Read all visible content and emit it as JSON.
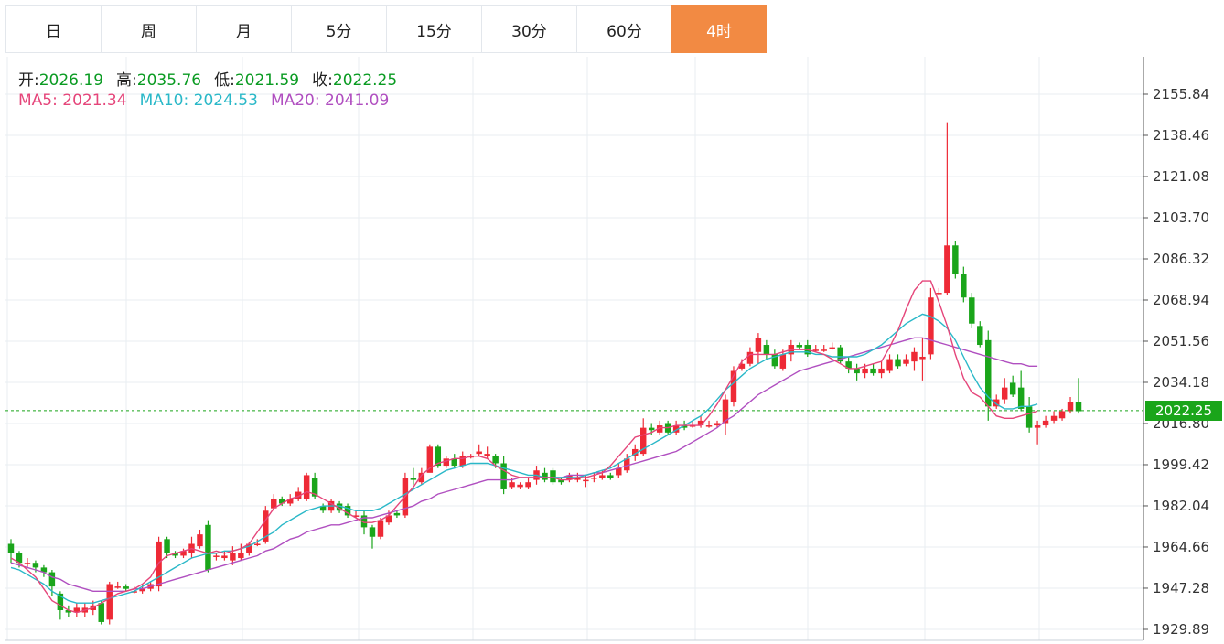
{
  "tabs": [
    {
      "label": "日",
      "active": false
    },
    {
      "label": "周",
      "active": false
    },
    {
      "label": "月",
      "active": false
    },
    {
      "label": "5分",
      "active": false
    },
    {
      "label": "15分",
      "active": false
    },
    {
      "label": "30分",
      "active": false
    },
    {
      "label": "60分",
      "active": false
    },
    {
      "label": "4时",
      "active": true
    }
  ],
  "ohlc": {
    "open_label": "开:",
    "open": "2026.19",
    "high_label": "高:",
    "high": "2035.76",
    "low_label": "低:",
    "low": "2021.59",
    "close_label": "收:",
    "close": "2022.25"
  },
  "ma": {
    "ma5_label": "MA5:",
    "ma5": "2021.34",
    "ma10_label": "MA10:",
    "ma10": "2024.53",
    "ma20_label": "MA20:",
    "ma20": "2041.09"
  },
  "current_price": "2022.25",
  "colors": {
    "up": "#ee2a36",
    "down": "#1aa51a",
    "ma5": "#e5457a",
    "ma10": "#2ab8c8",
    "ma20": "#b04fc0",
    "active_tab": "#f28a43"
  },
  "chart_data": {
    "type": "candlestick",
    "y_tick_labels": [
      "2155.84",
      "2138.46",
      "2121.08",
      "2103.70",
      "2086.32",
      "2068.94",
      "2051.56",
      "2034.18",
      "2016.80",
      "1999.42",
      "1982.04",
      "1964.66",
      "1947.28",
      "1929.89"
    ],
    "ylim": [
      1926,
      2165
    ],
    "current_price": 2022.25,
    "candles": [
      [
        1966,
        1962,
        1968,
        1958
      ],
      [
        1962,
        1958,
        1963,
        1956
      ],
      [
        1958,
        1958,
        1960,
        1956
      ],
      [
        1958,
        1956,
        1959,
        1954
      ],
      [
        1956,
        1954,
        1957,
        1952
      ],
      [
        1954,
        1948,
        1955,
        1944
      ],
      [
        1945,
        1938,
        1946,
        1934
      ],
      [
        1938,
        1937,
        1940,
        1935
      ],
      [
        1937,
        1939,
        1941,
        1935
      ],
      [
        1937,
        1939,
        1941,
        1935
      ],
      [
        1938,
        1940,
        1942,
        1936
      ],
      [
        1941,
        1933,
        1942,
        1932
      ],
      [
        1934,
        1949,
        1950,
        1932
      ],
      [
        1948,
        1948,
        1950,
        1947
      ],
      [
        1948,
        1947,
        1949,
        1946
      ],
      [
        1946,
        1946,
        1948,
        1945
      ],
      [
        1946,
        1947,
        1949,
        1945
      ],
      [
        1947,
        1949,
        1950,
        1946
      ],
      [
        1948,
        1967,
        1969,
        1946
      ],
      [
        1968,
        1962,
        1969,
        1960
      ],
      [
        1962,
        1961,
        1963,
        1960
      ],
      [
        1961,
        1963,
        1964,
        1960
      ],
      [
        1962,
        1966,
        1969,
        1960
      ],
      [
        1965,
        1970,
        1972,
        1964
      ],
      [
        1974,
        1955,
        1976,
        1954
      ],
      [
        1961,
        1961,
        1962,
        1959
      ],
      [
        1960,
        1961,
        1963,
        1959
      ],
      [
        1959,
        1962,
        1965,
        1957
      ],
      [
        1960,
        1962,
        1966,
        1959
      ],
      [
        1962,
        1966,
        1967,
        1961
      ],
      [
        1966,
        1966,
        1968,
        1965
      ],
      [
        1967,
        1980,
        1982,
        1966
      ],
      [
        1981,
        1985,
        1987,
        1980
      ],
      [
        1985,
        1983,
        1986,
        1982
      ],
      [
        1983,
        1985,
        1987,
        1982
      ],
      [
        1985,
        1988,
        1990,
        1984
      ],
      [
        1985,
        1995,
        1996,
        1984
      ],
      [
        1994,
        1986,
        1996,
        1985
      ],
      [
        1982,
        1980,
        1983,
        1979
      ],
      [
        1980,
        1984,
        1985,
        1979
      ],
      [
        1983,
        1980,
        1984,
        1979
      ],
      [
        1982,
        1978,
        1983,
        1977
      ],
      [
        1978,
        1978,
        1980,
        1977
      ],
      [
        1978,
        1973,
        1980,
        1970
      ],
      [
        1973,
        1969,
        1974,
        1964
      ],
      [
        1969,
        1976,
        1977,
        1968
      ],
      [
        1975,
        1978,
        1980,
        1974
      ],
      [
        1979,
        1978,
        1980,
        1977
      ],
      [
        1978,
        1994,
        1996,
        1977
      ],
      [
        1994,
        1993,
        1998,
        1991
      ],
      [
        1992,
        1996,
        1998,
        1991
      ],
      [
        1996,
        2007,
        2008,
        2003
      ],
      [
        2007,
        1999,
        2008,
        1998
      ],
      [
        1999,
        2002,
        2003,
        1998
      ],
      [
        2002,
        1999,
        2004,
        1998
      ],
      [
        1999,
        2003,
        2005,
        1998
      ],
      [
        2003,
        2003,
        2004,
        2002
      ],
      [
        2004,
        2005,
        2008,
        2003
      ],
      [
        2003,
        2004,
        2007,
        2002
      ],
      [
        2003,
        2000,
        2004,
        1998
      ],
      [
        2000,
        1989,
        2003,
        1987
      ],
      [
        1990,
        1992,
        1994,
        1989
      ],
      [
        1990,
        1991,
        1992,
        1989
      ],
      [
        1990,
        1992,
        1994,
        1989
      ],
      [
        1993,
        1997,
        1999,
        1991
      ],
      [
        1996,
        1993,
        1998,
        1992
      ],
      [
        1997,
        1992,
        1998,
        1991
      ],
      [
        1993,
        1992,
        1994,
        1991
      ],
      [
        1993,
        1995,
        1996,
        1992
      ],
      [
        1993,
        1994,
        1996,
        1992
      ],
      [
        1993,
        1993,
        1995,
        1990
      ],
      [
        1994,
        1994,
        1996,
        1992
      ],
      [
        1994,
        1995,
        1997,
        1993
      ],
      [
        1995,
        1994,
        1996,
        1993
      ],
      [
        1995,
        1998,
        2000,
        1994
      ],
      [
        1997,
        2002,
        2004,
        1996
      ],
      [
        2003,
        2006,
        2008,
        2001
      ],
      [
        2004,
        2015,
        2019,
        2003
      ],
      [
        2015,
        2014,
        2017,
        2012
      ],
      [
        2013,
        2016,
        2018,
        2012
      ],
      [
        2017,
        2013,
        2018,
        2012
      ],
      [
        2013,
        2016,
        2018,
        2012
      ],
      [
        2016,
        2015,
        2018,
        2014
      ],
      [
        2016,
        2016,
        2018,
        2015
      ],
      [
        2016,
        2018,
        2020,
        2015
      ],
      [
        2016,
        2016,
        2018,
        2015
      ],
      [
        2016,
        2017,
        2018,
        2015
      ],
      [
        2017,
        2027,
        2029,
        2012
      ],
      [
        2026,
        2039,
        2041,
        2024
      ],
      [
        2040,
        2042,
        2044,
        2039
      ],
      [
        2042,
        2047,
        2049,
        2041
      ],
      [
        2047,
        2053,
        2055,
        2042
      ],
      [
        2050,
        2046,
        2052,
        2044
      ],
      [
        2046,
        2041,
        2048,
        2040
      ],
      [
        2040,
        2046,
        2048,
        2039
      ],
      [
        2046,
        2050,
        2052,
        2043
      ],
      [
        2050,
        2049,
        2051,
        2048
      ],
      [
        2050,
        2046,
        2052,
        2045
      ],
      [
        2048,
        2048,
        2050,
        2047
      ],
      [
        2048,
        2048,
        2050,
        2047
      ],
      [
        2049,
        2049,
        2051,
        2048
      ],
      [
        2049,
        2043,
        2050,
        2042
      ],
      [
        2043,
        2040,
        2045,
        2038
      ],
      [
        2040,
        2038,
        2042,
        2035
      ],
      [
        2038,
        2040,
        2042,
        2036
      ],
      [
        2040,
        2038,
        2042,
        2037
      ],
      [
        2038,
        2040,
        2043,
        2036
      ],
      [
        2039,
        2044,
        2046,
        2038
      ],
      [
        2044,
        2041,
        2046,
        2040
      ],
      [
        2042,
        2044,
        2046,
        2041
      ],
      [
        2043,
        2047,
        2049,
        2039
      ],
      [
        2044,
        2045,
        2053,
        2035
      ],
      [
        2046,
        2070,
        2074,
        2044
      ],
      [
        2072,
        2072,
        2074,
        2071
      ],
      [
        2072,
        2092,
        2144,
        2071
      ],
      [
        2092,
        2080,
        2094,
        2078
      ],
      [
        2080,
        2070,
        2083,
        2068
      ],
      [
        2070,
        2059,
        2072,
        2057
      ],
      [
        2058,
        2050,
        2060,
        2049
      ],
      [
        2052,
        2024,
        2056,
        2018
      ],
      [
        2024,
        2027,
        2029,
        2023
      ],
      [
        2027,
        2032,
        2036,
        2025
      ],
      [
        2034,
        2029,
        2037,
        2028
      ],
      [
        2032,
        2023,
        2039,
        2022
      ],
      [
        2024,
        2015,
        2028,
        2013
      ],
      [
        2015,
        2016,
        2018,
        2008
      ],
      [
        2016,
        2018,
        2020,
        2015
      ],
      [
        2018,
        2020,
        2022,
        2017
      ],
      [
        2019,
        2022,
        2023,
        2018
      ],
      [
        2022,
        2026,
        2028,
        2021
      ],
      [
        2026,
        2022,
        2036,
        2021
      ]
    ],
    "ma5": [
      1960,
      1958,
      1955,
      1952,
      1947,
      1942,
      1940,
      1938,
      1937,
      1938,
      1939,
      1941,
      1943,
      1945,
      1946,
      1947,
      1949,
      1952,
      1958,
      1961,
      1962,
      1963,
      1964,
      1963,
      1962,
      1963,
      1962,
      1963,
      1964,
      1966,
      1971,
      1976,
      1981,
      1983,
      1985,
      1986,
      1988,
      1987,
      1985,
      1983,
      1981,
      1979,
      1977,
      1975,
      1975,
      1976,
      1978,
      1982,
      1986,
      1990,
      1995,
      1998,
      2000,
      2001,
      2002,
      2002,
      2003,
      2003,
      2002,
      1999,
      1997,
      1995,
      1994,
      1994,
      1994,
      1994,
      1994,
      1993,
      1993,
      1994,
      1994,
      1995,
      1996,
      1999,
      2003,
      2007,
      2011,
      2012,
      2013,
      2015,
      2015,
      2016,
      2016,
      2016,
      2016,
      2020,
      2025,
      2031,
      2037,
      2043,
      2046,
      2046,
      2046,
      2046,
      2047,
      2048,
      2048,
      2048,
      2047,
      2046,
      2044,
      2042,
      2040,
      2040,
      2041,
      2042,
      2043,
      2049,
      2056,
      2065,
      2073,
      2077,
      2077,
      2068,
      2058,
      2046,
      2036,
      2030,
      2028,
      2024,
      2020,
      2019,
      2019,
      2020,
      2021,
      2022
    ],
    "ma10": [
      1956,
      1955,
      1953,
      1951,
      1949,
      1946,
      1944,
      1942,
      1941,
      1941,
      1941,
      1942,
      1943,
      1944,
      1945,
      1946,
      1948,
      1950,
      1952,
      1954,
      1956,
      1958,
      1960,
      1961,
      1962,
      1962,
      1963,
      1963,
      1964,
      1965,
      1967,
      1969,
      1971,
      1974,
      1976,
      1978,
      1980,
      1981,
      1982,
      1982,
      1982,
      1981,
      1980,
      1980,
      1980,
      1981,
      1983,
      1985,
      1987,
      1989,
      1991,
      1993,
      1995,
      1997,
      1998,
      1999,
      2000,
      2000,
      2000,
      1999,
      1998,
      1997,
      1996,
      1995,
      1995,
      1994,
      1994,
      1994,
      1994,
      1994,
      1995,
      1996,
      1997,
      1998,
      2000,
      2002,
      2004,
      2006,
      2008,
      2010,
      2012,
      2014,
      2016,
      2018,
      2020,
      2023,
      2027,
      2031,
      2034,
      2037,
      2040,
      2042,
      2044,
      2045,
      2046,
      2047,
      2047,
      2047,
      2046,
      2046,
      2045,
      2045,
      2045,
      2045,
      2046,
      2048,
      2050,
      2053,
      2056,
      2059,
      2061,
      2063,
      2062,
      2060,
      2057,
      2052,
      2045,
      2038,
      2032,
      2028,
      2025,
      2023,
      2023,
      2024,
      2024,
      2025
    ],
    "ma20": [
      1958,
      1957,
      1956,
      1955,
      1954,
      1952,
      1951,
      1949,
      1948,
      1947,
      1946,
      1946,
      1946,
      1946,
      1946,
      1947,
      1947,
      1948,
      1949,
      1950,
      1951,
      1952,
      1953,
      1954,
      1955,
      1956,
      1957,
      1958,
      1959,
      1960,
      1961,
      1963,
      1964,
      1966,
      1968,
      1969,
      1971,
      1972,
      1973,
      1974,
      1974,
      1975,
      1976,
      1977,
      1977,
      1978,
      1979,
      1980,
      1981,
      1982,
      1984,
      1985,
      1987,
      1988,
      1989,
      1990,
      1991,
      1992,
      1993,
      1993,
      1993,
      1993,
      1994,
      1994,
      1994,
      1994,
      1994,
      1994,
      1995,
      1995,
      1995,
      1996,
      1996,
      1997,
      1998,
      1999,
      2000,
      2001,
      2002,
      2003,
      2004,
      2005,
      2007,
      2009,
      2011,
      2013,
      2015,
      2018,
      2020,
      2023,
      2026,
      2029,
      2031,
      2033,
      2035,
      2037,
      2039,
      2040,
      2041,
      2042,
      2043,
      2044,
      2045,
      2046,
      2047,
      2048,
      2049,
      2050,
      2051,
      2052,
      2053,
      2053,
      2052,
      2051,
      2050,
      2049,
      2048,
      2047,
      2046,
      2045,
      2044,
      2043,
      2042,
      2042,
      2041,
      2041
    ]
  }
}
